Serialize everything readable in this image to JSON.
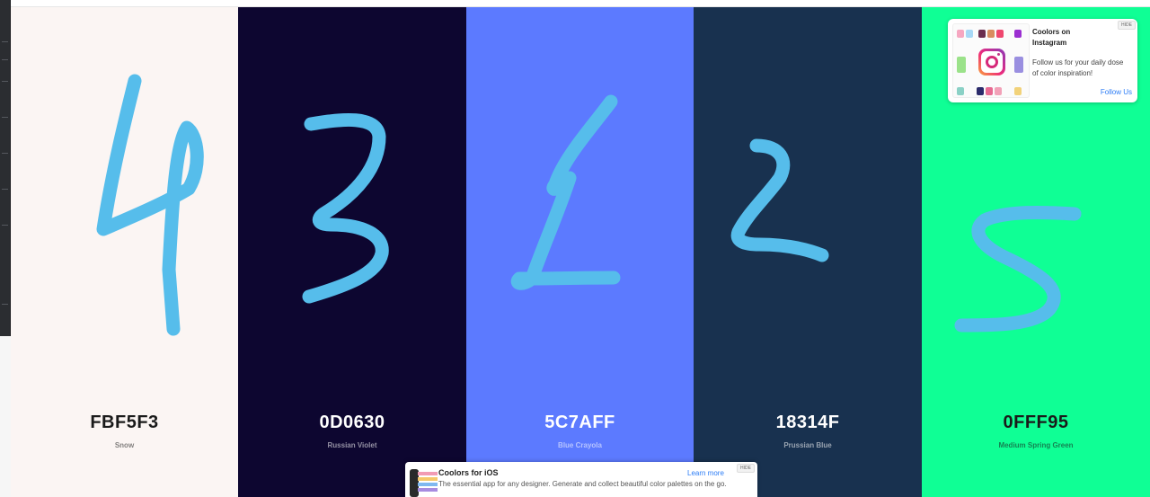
{
  "palette": {
    "swatches": [
      {
        "hex": "FBF5F3",
        "name": "Snow",
        "background": "#FBF5F3",
        "text_color": "#1a1a1a"
      },
      {
        "hex": "0D0630",
        "name": "Russian Violet",
        "background": "#0D0630",
        "text_color": "#ffffff"
      },
      {
        "hex": "5C7AFF",
        "name": "Blue Crayola",
        "background": "#5C7AFF",
        "text_color": "#ffffff"
      },
      {
        "hex": "18314F",
        "name": "Prussian Blue",
        "background": "#18314F",
        "text_color": "#ffffff"
      },
      {
        "hex": "0FFF95",
        "name": "Medium Spring Green",
        "background": "#0FFF95",
        "text_color": "#1a1a1a"
      }
    ]
  },
  "annotations": {
    "digits": [
      "4",
      "3",
      "1",
      "2",
      "5"
    ],
    "stroke_color": "#56BDEB"
  },
  "instagram_promo": {
    "title": "Coolors on Instagram",
    "text": "Follow us for your daily dose of color inspiration!",
    "follow_label": "Follow Us",
    "hide_label": "HIDE",
    "icon": "instagram-icon"
  },
  "ios_promo": {
    "title": "Coolors for iOS",
    "text": "The essential app for any designer. Generate and collect beautiful color palettes on the go.",
    "learn_label": "Learn more",
    "hide_label": "HIDE"
  }
}
